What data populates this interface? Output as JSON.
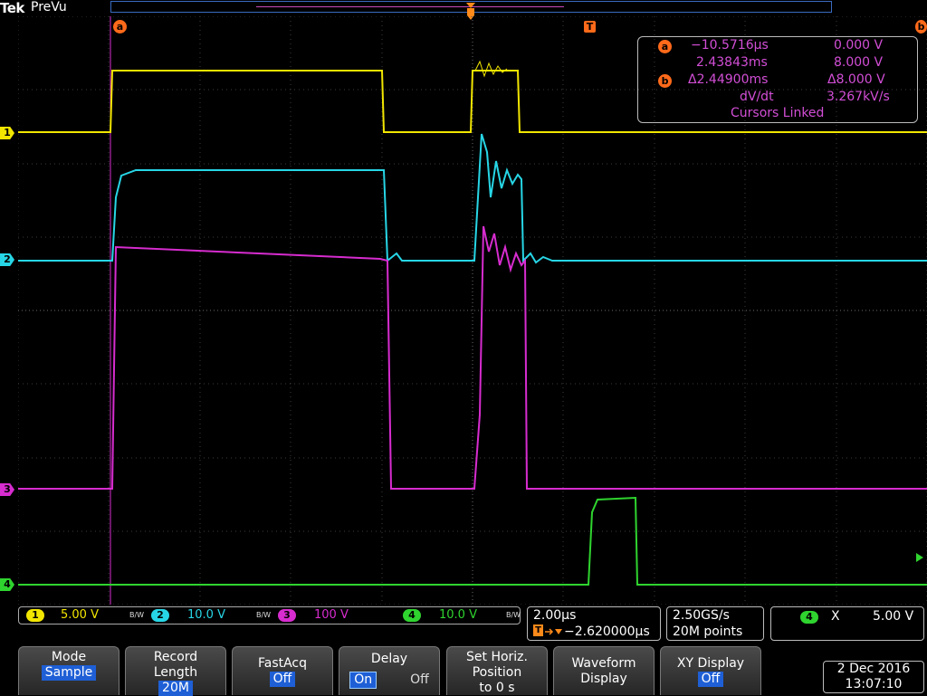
{
  "header": {
    "brand": "Tek",
    "mode": "PreVu"
  },
  "channels": [
    {
      "id": "1",
      "color": "#f2e600",
      "scale": "5.00 V"
    },
    {
      "id": "2",
      "color": "#27d6e6",
      "scale": "10.0 V"
    },
    {
      "id": "3",
      "color": "#d72ccf",
      "scale": "100 V"
    },
    {
      "id": "4",
      "color": "#2fd42f",
      "scale": "10.0 V"
    }
  ],
  "bw_label": "B/W",
  "cursor_tags": {
    "a": "a",
    "b": "b",
    "trigger": "T"
  },
  "readout": {
    "a_time": "−10.5716µs",
    "a_volt": "0.000 V",
    "b_time": "2.43843ms",
    "b_volt": "8.000 V",
    "delta_time": "Δ2.44900ms",
    "delta_volt": "Δ8.000 V",
    "dvdt_label": "dV/dt",
    "dvdt_value": "3.267kV/s",
    "linked": "Cursors Linked"
  },
  "horizontal": {
    "scale": "2.00µs",
    "trigger_pos": "−2.620000µs"
  },
  "acquisition": {
    "rate": "2.50GS/s",
    "points": "20M points"
  },
  "xy_readout": {
    "channel": "4",
    "label": "X",
    "value": "5.00 V"
  },
  "menu": {
    "mode": {
      "label": "Mode",
      "value": "Sample"
    },
    "record": {
      "label1": "Record",
      "label2": "Length",
      "value": "20M"
    },
    "fastacq": {
      "label": "FastAcq",
      "value": "Off"
    },
    "delay": {
      "label": "Delay",
      "on": "On",
      "off": "Off"
    },
    "horiz": {
      "label1": "Set Horiz.",
      "label2": "Position",
      "label3": "to 0 s"
    },
    "waveform": {
      "label1": "Waveform",
      "label2": "Display"
    },
    "xy": {
      "label": "XY Display",
      "value": "Off"
    }
  },
  "datetime": {
    "date": "2 Dec 2016",
    "time": "13:07:10"
  }
}
